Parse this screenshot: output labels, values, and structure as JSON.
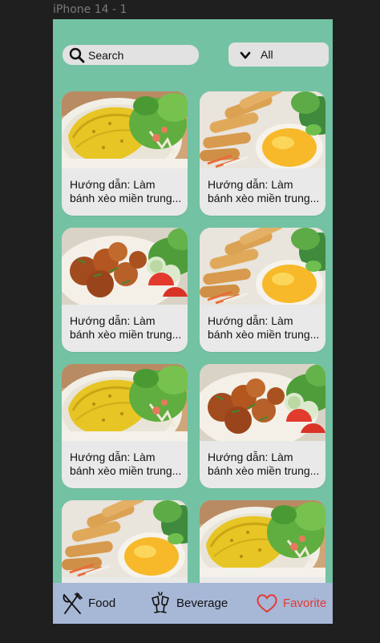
{
  "frame_label": "iPhone 14 - 1",
  "search": {
    "label": "Search",
    "icon": "search-icon"
  },
  "filter": {
    "label": "All",
    "icon": "chevron-down-icon"
  },
  "recipes": [
    {
      "title": "Hướng dẫn: Làm bánh xèo miền trung...",
      "image": "banh-xeo"
    },
    {
      "title": "Hướng dẫn: Làm bánh xèo miền trung...",
      "image": "spring-rolls"
    },
    {
      "title": "Hướng dẫn: Làm bánh xèo miền trung...",
      "image": "braised-meat"
    },
    {
      "title": "Hướng dẫn: Làm bánh xèo miền trung...",
      "image": "spring-rolls"
    },
    {
      "title": "Hướng dẫn: Làm bánh xèo miền trung...",
      "image": "banh-xeo"
    },
    {
      "title": "Hướng dẫn: Làm bánh xèo miền trung...",
      "image": "braised-meat"
    },
    {
      "title": "",
      "image": "spring-rolls"
    },
    {
      "title": "",
      "image": "banh-xeo"
    }
  ],
  "tabbar": {
    "food": {
      "label": "Food",
      "icon": "fork-knife-icon"
    },
    "beverage": {
      "label": "Beverage",
      "icon": "glasses-cheers-icon"
    },
    "favorite": {
      "label": "Favorite",
      "icon": "heart-icon",
      "active": true
    }
  },
  "colors": {
    "screen_bg": "#74c2a4",
    "tabbar_bg": "#a7b7d6",
    "card_bg": "#e9e9e9",
    "favorite_accent": "#e53935"
  }
}
